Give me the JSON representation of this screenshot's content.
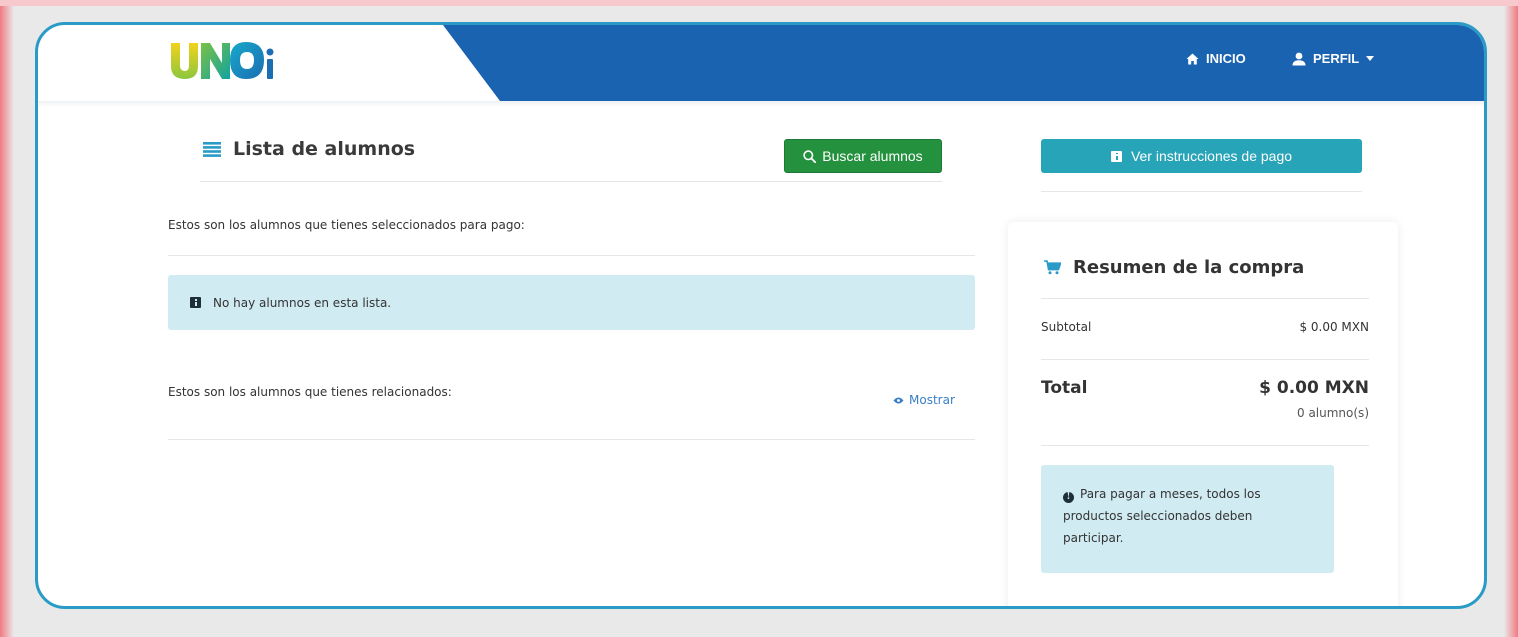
{
  "header": {
    "logo_text": "UNOi",
    "nav": [
      {
        "label": "INICIO",
        "icon": "home-icon"
      },
      {
        "label": "PERFIL",
        "icon": "user-icon"
      }
    ],
    "colors": {
      "bar": "#1a63b0",
      "frame": "#2a9bc6"
    }
  },
  "main": {
    "title": "Lista de alumnos",
    "search_button": "Buscar alumnos",
    "selected_text": "Estos son los alumnos que tienes seleccionados para pago:",
    "empty_alert": "No hay alumnos en esta lista.",
    "related_text": "Estos son los alumnos que tienes relacionados:",
    "show_link": "Mostrar"
  },
  "sidebar": {
    "instructions_button": "Ver instrucciones de pago",
    "summary": {
      "title": "Resumen de la compra",
      "subtotal_label": "Subtotal",
      "subtotal_value": "$ 0.00 MXN",
      "total_label": "Total",
      "total_value": "$ 0.00 MXN",
      "count": "0 alumno(s)",
      "notice": "Para pagar a meses, todos los productos seleccionados deben participar."
    }
  },
  "colors": {
    "search_button": "#23913e",
    "instructions_button": "#27a4b8",
    "alert_bg": "#d1ebf2",
    "link": "#3a7fc4"
  }
}
